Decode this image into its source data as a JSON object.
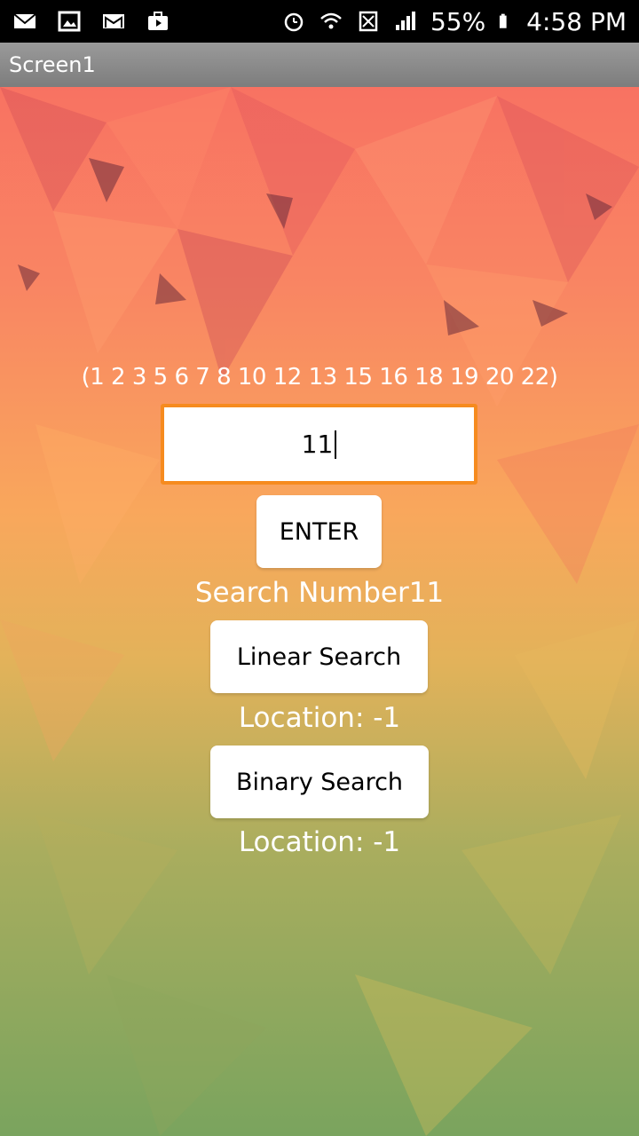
{
  "status_bar": {
    "notifications": [
      "mail-icon",
      "image-icon",
      "gmail-icon",
      "briefcase-icon"
    ],
    "system_icons": [
      "alarm-icon",
      "wifi-icon",
      "sim-icon",
      "signal-icon"
    ],
    "battery_percent": "55%",
    "time": "4:58 PM"
  },
  "titlebar": {
    "title": "Screen1"
  },
  "main": {
    "array_text": "(1 2 3 5 6 7 8 10 12 13 15 16 18 19 20 22)",
    "input_value": "11",
    "enter_label": "ENTER",
    "search_number_text": "Search Number11",
    "linear_label": "Linear Search",
    "linear_location": "Location: -1",
    "binary_label": "Binary Search",
    "binary_location": "Location: -1"
  },
  "colors": {
    "input_border": "#f68b1f",
    "titlebar": "#8c8c8c",
    "background_top": "#f86a62",
    "background_bottom": "#7aa45e"
  }
}
